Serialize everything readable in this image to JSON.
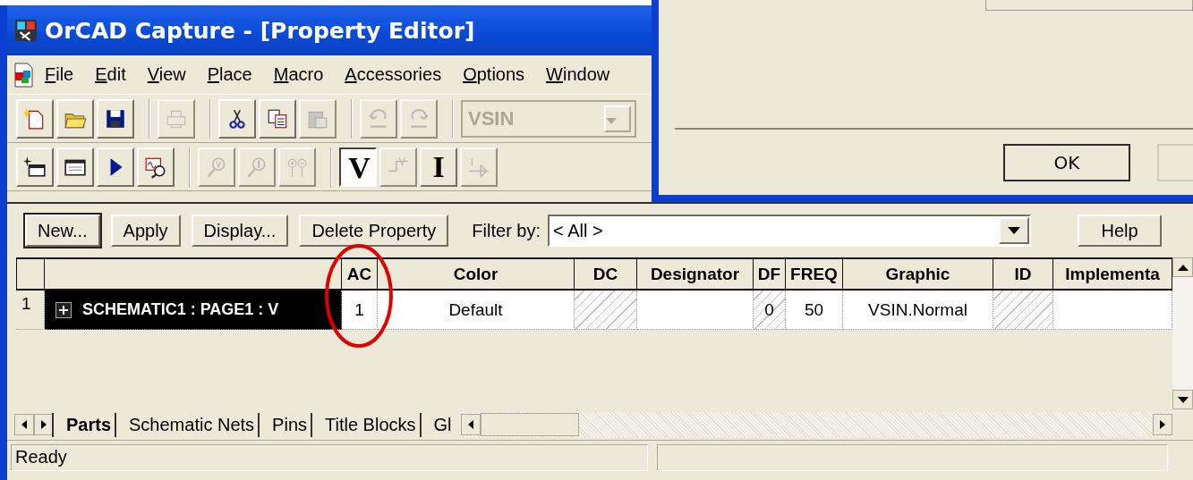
{
  "window": {
    "title": "OrCAD Capture - [Property Editor]"
  },
  "menu": [
    {
      "label": "File"
    },
    {
      "label": "Edit"
    },
    {
      "label": "View"
    },
    {
      "label": "Place"
    },
    {
      "label": "Macro"
    },
    {
      "label": "Accessories"
    },
    {
      "label": "Options"
    },
    {
      "label": "Window"
    }
  ],
  "toolbars": [
    {
      "groups": [
        {
          "buttons": [
            {
              "kind": "icon",
              "disabled": false,
              "pressed": false
            },
            {
              "kind": "icon",
              "disabled": false,
              "pressed": false
            },
            {
              "kind": "icon",
              "disabled": false,
              "pressed": false
            }
          ]
        },
        {
          "buttons": [
            {
              "kind": "icon",
              "disabled": true,
              "pressed": false
            }
          ]
        },
        {
          "buttons": [
            {
              "kind": "icon",
              "disabled": false,
              "pressed": false
            },
            {
              "kind": "icon",
              "disabled": false,
              "pressed": false
            },
            {
              "kind": "icon",
              "disabled": true,
              "pressed": false
            }
          ]
        },
        {
          "buttons": [
            {
              "kind": "icon",
              "disabled": true,
              "pressed": false
            },
            {
              "kind": "icon",
              "disabled": true,
              "pressed": false
            }
          ]
        },
        {
          "buttons": [
            {
              "kind": "combo",
              "value": "VSIN",
              "disabled": true
            }
          ]
        }
      ]
    },
    {
      "groups": [
        {
          "buttons": [
            {
              "kind": "icon",
              "disabled": false,
              "pressed": false
            },
            {
              "kind": "icon",
              "disabled": false,
              "pressed": false
            },
            {
              "kind": "icon",
              "disabled": false,
              "pressed": false
            },
            {
              "kind": "icon",
              "disabled": false,
              "pressed": false
            }
          ]
        },
        {
          "buttons": [
            {
              "kind": "icon",
              "disabled": true,
              "pressed": false
            },
            {
              "kind": "icon",
              "disabled": true,
              "pressed": false
            },
            {
              "kind": "icon",
              "disabled": true,
              "pressed": false
            }
          ]
        },
        {
          "buttons": [
            {
              "kind": "text",
              "label": "V",
              "disabled": false,
              "pressed": true
            },
            {
              "kind": "icon",
              "disabled": true,
              "pressed": false
            },
            {
              "kind": "text",
              "label": "I",
              "disabled": false,
              "pressed": false
            },
            {
              "kind": "icon",
              "disabled": true,
              "pressed": false
            }
          ]
        }
      ]
    }
  ],
  "dialog": {
    "ok_button": "OK"
  },
  "editor": {
    "buttons": [
      {
        "label": "New...",
        "default": true
      },
      {
        "label": "Apply",
        "default": false
      },
      {
        "label": "Display...",
        "default": false
      },
      {
        "label": "Delete Property",
        "default": false
      }
    ],
    "filter": {
      "label": "Filter by:",
      "value": "< All >"
    },
    "help_button": "Help",
    "columns": [
      "AC",
      "Color",
      "DC",
      "Designator",
      "DF",
      "FREQ",
      "Graphic",
      "ID",
      "Implementa"
    ],
    "rows": [
      {
        "number": "1",
        "name": "SCHEMATIC1 : PAGE1 : V",
        "selected": true,
        "expanded": false,
        "cells": [
          {
            "text": "1",
            "hatched": false
          },
          {
            "text": "Default",
            "hatched": false
          },
          {
            "hatched": true
          },
          {
            "hatched": false
          },
          {
            "text": "0",
            "hatched": true
          },
          {
            "text": "50",
            "hatched": false
          },
          {
            "text": "VSIN.Normal",
            "hatched": false
          },
          {
            "hatched": true
          },
          {
            "hatched": false
          }
        ]
      }
    ],
    "tabs": [
      {
        "label": "Parts",
        "selected": true
      },
      {
        "label": "Schematic Nets",
        "selected": false
      },
      {
        "label": "Pins",
        "selected": false
      },
      {
        "label": "Title Blocks",
        "selected": false
      },
      {
        "label": "Gl",
        "selected": false
      }
    ],
    "annotation": {
      "kind": "ellipse"
    }
  },
  "status_bar": {
    "text": "Ready"
  }
}
